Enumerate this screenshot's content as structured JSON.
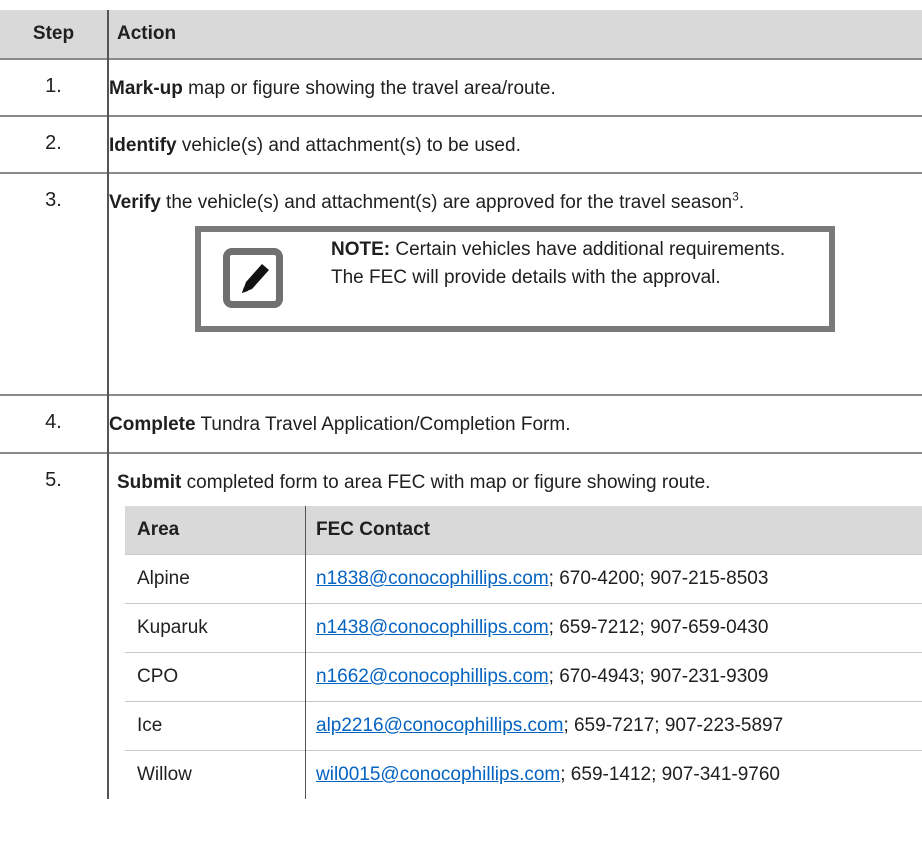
{
  "header": {
    "step": "Step",
    "action": "Action"
  },
  "steps": [
    {
      "num": "1.",
      "verb": "Mark-up",
      "rest": " map or figure showing the travel area/route."
    },
    {
      "num": "2.",
      "verb": "Identify",
      "rest": " vehicle(s) and attachment(s) to be used."
    },
    {
      "num": "3.",
      "verb": "Verify",
      "rest": " the vehicle(s) and attachment(s) are approved for the travel season",
      "sup": "3",
      "tail": "."
    },
    {
      "num": "4.",
      "verb": "Complete",
      "rest": " Tundra Travel Application/Completion Form."
    },
    {
      "num": "5.",
      "verb": "Submit",
      "rest": " completed form to area FEC with map or figure showing route."
    }
  ],
  "note": {
    "label": "NOTE:",
    "text": " Certain vehicles have additional requirements. The FEC will provide details with the approval.",
    "icon": "edit-note-icon"
  },
  "contacts": {
    "headers": {
      "area": "Area",
      "fec": "FEC Contact"
    },
    "rows": [
      {
        "area": "Alpine",
        "email": "n1838@conocophillips.com",
        "phones": "; 670-4200; 907-215-8503"
      },
      {
        "area": "Kuparuk",
        "email": "n1438@conocophillips.com",
        "phones": "; 659-7212; 907-659-0430"
      },
      {
        "area": "CPO",
        "email": "n1662@conocophillips.com",
        "phones": "; 670-4943; 907-231-9309"
      },
      {
        "area": "Ice",
        "email": "alp2216@conocophillips.com",
        "phones": "; 659-7217; 907-223-5897"
      },
      {
        "area": "Willow",
        "email": "wil0015@conocophillips.com",
        "phones": "; 659-1412; 907-341-9760"
      }
    ]
  },
  "colors": {
    "header_bg": "#d9d9d9",
    "link": "#0563c1",
    "note_border": "#7a7a7a"
  }
}
